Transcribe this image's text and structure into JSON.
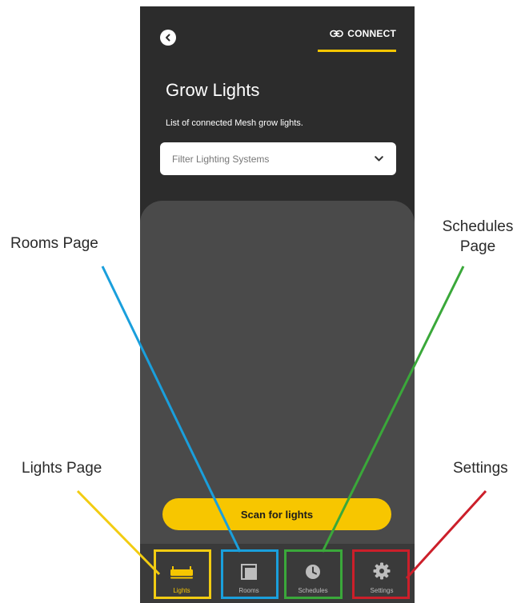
{
  "header": {
    "connect_label": "CONNECT"
  },
  "main": {
    "title": "Grow Lights",
    "subtitle": "List of connected Mesh grow lights.",
    "filter_placeholder": "Filter Lighting Systems",
    "scan_button": "Scan for lights"
  },
  "nav": {
    "items": [
      {
        "label": "Lights",
        "icon": "grow-light-icon",
        "active": true
      },
      {
        "label": "Rooms",
        "icon": "rooms-icon",
        "active": false
      },
      {
        "label": "Schedules",
        "icon": "clock-icon",
        "active": false
      },
      {
        "label": "Settings",
        "icon": "gear-icon",
        "active": false
      }
    ]
  },
  "annotations": {
    "rooms_page": "Rooms Page",
    "schedules_page_line1": "Schedules",
    "schedules_page_line2": "Page",
    "lights_page": "Lights Page",
    "settings": "Settings"
  },
  "colors": {
    "accent": "#f7c600",
    "background": "#2c2c2c",
    "panel": "#4a4a4a",
    "lights_highlight": "#f2cc12",
    "rooms_highlight": "#1a9fdc",
    "schedules_highlight": "#3aa83a",
    "settings_highlight": "#cc1f2a"
  }
}
